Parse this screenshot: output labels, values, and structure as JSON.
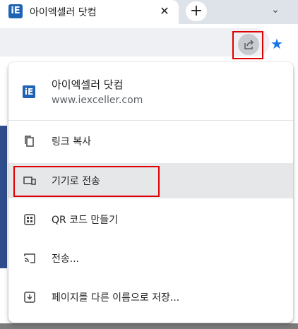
{
  "tab": {
    "favicon_text": "iE",
    "title": "아이엑셀러 닷컴",
    "close_glyph": "✕",
    "new_tab_glyph": "+",
    "tab_search_glyph": "⌄"
  },
  "toolbar": {
    "star_glyph": "★"
  },
  "share_menu": {
    "site_icon_text": "iE",
    "site_name": "아이엑셀러 닷컴",
    "site_url": "www.iexceller.com",
    "items": [
      {
        "label": "링크 복사",
        "icon": "copy-icon"
      },
      {
        "label": "기기로 전송",
        "icon": "devices-icon",
        "active": true
      },
      {
        "label": "QR 코드 만들기",
        "icon": "qr-code-icon"
      },
      {
        "label": "전송...",
        "icon": "cast-icon"
      },
      {
        "label": "페이지를 다른 이름으로 저장...",
        "icon": "save-page-icon"
      }
    ]
  },
  "colors": {
    "accent": "#1a73e8",
    "highlight_border": "#e00000",
    "site_icon": "#1f63b4"
  }
}
